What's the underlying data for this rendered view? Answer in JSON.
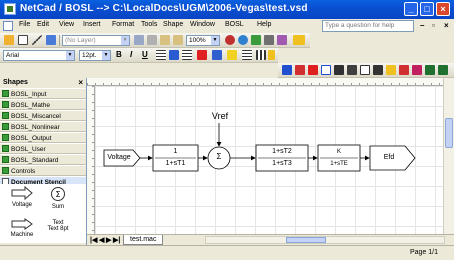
{
  "window": {
    "title": "NetCad / BOSL  --> C:\\LocalDocs\\UGM\\2006-Vegas\\test.vsd"
  },
  "menu": {
    "items": [
      "File",
      "Edit",
      "View",
      "Insert",
      "Format",
      "Tools",
      "Shape",
      "Window",
      "BOSL",
      "Help"
    ],
    "help_placeholder": "Type a question for help"
  },
  "toolbar": {
    "layer_combo": "(No Layer)",
    "zoom": "100%",
    "font": "Arial",
    "font_size": "12pt.",
    "bold": "B",
    "italic": "I",
    "underline": "U"
  },
  "shapes_pane": {
    "title": "Shapes",
    "close": "×",
    "stencils": [
      "BOSL_Input",
      "BOSL_Mathe",
      "BOSL_Miscancel",
      "BOSL_Nonlinear",
      "BOSL_Output",
      "BOSL_User",
      "BOSL_Standard",
      "Controls"
    ],
    "document_stencil": "Document Stencil",
    "masters": [
      "Voltage",
      "Sum",
      "Machine",
      "Text 8pt"
    ],
    "master_glyphs": {
      "sum": "Σ",
      "text": "Text"
    }
  },
  "diagram": {
    "voltage": "Voltage",
    "block1_num": "1",
    "block1_den": "1+sT1",
    "sum": "Σ",
    "vref": "Vref",
    "block2_num": "1+sT2",
    "block2_den": "1+sT3",
    "block3_num": "K",
    "block3_den": "1+sTE",
    "efd": "Efd"
  },
  "tabs": {
    "nav": [
      "|◀",
      "◀",
      "▶",
      "▶|"
    ],
    "page": "test.mac"
  },
  "status": {
    "page": "Page 1/1"
  }
}
